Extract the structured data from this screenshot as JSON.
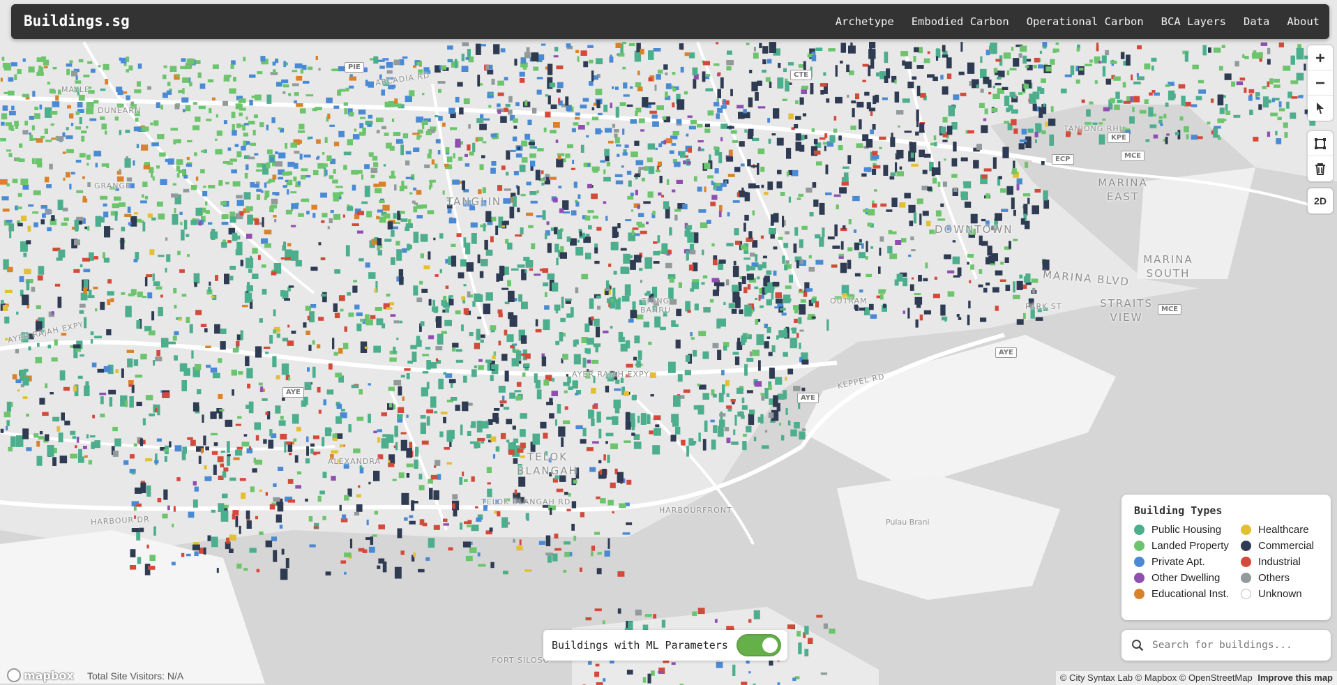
{
  "app": {
    "title": "Buildings.sg"
  },
  "nav": {
    "links": [
      "Archetype",
      "Embodied Carbon",
      "Operational Carbon",
      "BCA Layers",
      "Data",
      "About"
    ]
  },
  "controls": {
    "zoom_in_icon": "plus-icon",
    "zoom_out_icon": "minus-icon",
    "compass_icon": "compass-arrow-icon",
    "draw_polygon_icon": "polygon-icon",
    "delete_icon": "trash-icon",
    "view_mode_label": "2D"
  },
  "legend": {
    "title": "Building Types",
    "items": [
      {
        "label": "Public Housing",
        "color": "#4cae8c"
      },
      {
        "label": "Healthcare",
        "color": "#e3bf33"
      },
      {
        "label": "Landed Property",
        "color": "#6cc46c"
      },
      {
        "label": "Commercial",
        "color": "#2e3b52"
      },
      {
        "label": "Private Apt.",
        "color": "#4a8ad4"
      },
      {
        "label": "Industrial",
        "color": "#d44a3a"
      },
      {
        "label": "Other Dwelling",
        "color": "#8e4fb0"
      },
      {
        "label": "Others",
        "color": "#929a9c"
      },
      {
        "label": "Educational Inst.",
        "color": "#d9822b"
      },
      {
        "label": "Unknown",
        "color": "#ffffff"
      }
    ]
  },
  "search": {
    "placeholder": "Search for buildings...",
    "icon": "search-icon"
  },
  "ml_toggle": {
    "label": "Buildings with ML Parameters",
    "enabled": true,
    "color": "#66b04a"
  },
  "footer": {
    "mapbox_logo": "mapbox",
    "visitors": "Total Site Visitors: N/A",
    "attribution": "© City Syntax Lab © Mapbox © OpenStreetMap",
    "improve_link": "Improve this map"
  },
  "map_labels": [
    "TANGLIN",
    "DOWNTOWN",
    "MARINA BLVD",
    "MARINA SOUTH",
    "MARINA EAST",
    "STRAITS VIEW",
    "PARK ST",
    "KEPPEL RD",
    "AYER RAJAH EXPY",
    "TELOK BLANGAH RD",
    "TELOK BLANGAH",
    "HARBOUR DR",
    "HARBOURFRONT",
    "ALEXANDRA",
    "TIONG BAHRU",
    "OUTRAM",
    "FORT SILOSO",
    "ARCADIA RD",
    "Pulau Brani",
    "TANJONG RHU",
    "DUNEARN",
    "MAYLE",
    "GRANGE"
  ],
  "road_shields": [
    "PIE",
    "CTE",
    "AYE",
    "MCE",
    "KPE",
    "ECP"
  ]
}
